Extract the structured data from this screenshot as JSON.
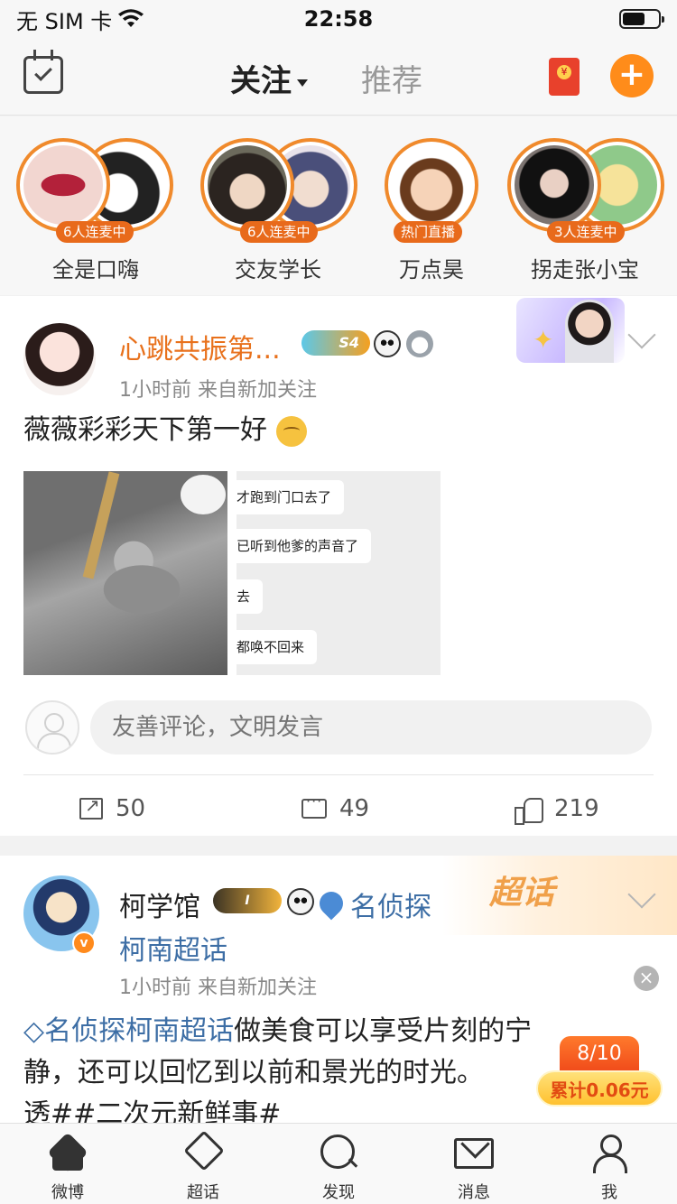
{
  "status_bar": {
    "carrier": "无 SIM 卡",
    "time": "22:58",
    "battery_level": 0.62
  },
  "nav": {
    "tabs": [
      {
        "label": "关注",
        "active": true
      },
      {
        "label": "推荐",
        "active": false
      }
    ],
    "plus_label": "+"
  },
  "live": [
    {
      "name": "全是口嗨",
      "badge": "6人连麦中"
    },
    {
      "name": "交友学长",
      "badge": "6人连麦中"
    },
    {
      "name": "万点昊",
      "badge": "热门直播"
    },
    {
      "name": "拐走张小宝",
      "badge": "3人连麦中"
    }
  ],
  "post1": {
    "user": "心跳共振第...",
    "level": "S4",
    "meta": "1小时前  来自新加关注",
    "text": "薇薇彩彩天下第一好",
    "chat_lines": [
      "才跑到门口去了",
      "已听到他爹的声音了",
      "去",
      "都唤不回来"
    ],
    "comment_placeholder": "友善评论，文明发言",
    "actions": {
      "repost": "50",
      "comment": "49",
      "like": "219"
    }
  },
  "post2": {
    "user": "柯学馆",
    "level": "I",
    "verified_mark": "v",
    "supertopic_line1": "名侦探",
    "supertopic_line2": "柯南超话",
    "banner": "超话",
    "meta": "1小时前  来自新加关注",
    "text_topic": "名侦探柯南超话",
    "text_line1": "做美食可以享受片刻的宁",
    "text_line2": "静，还可以回忆到以前和景光的时光。",
    "text_line3": "透##二次元新鲜事#",
    "close": "×"
  },
  "reward": {
    "progress": "8/10",
    "total": "累计0.06元"
  },
  "tabbar": [
    {
      "label": "微博"
    },
    {
      "label": "超话"
    },
    {
      "label": "发现"
    },
    {
      "label": "消息"
    },
    {
      "label": "我"
    }
  ],
  "colors": {
    "accent": "#ff8c1a",
    "link": "#3d6ea5",
    "username": "#e8711c"
  }
}
